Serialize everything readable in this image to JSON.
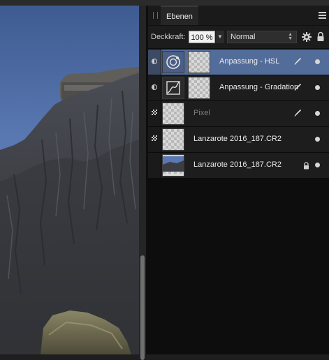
{
  "panel": {
    "tab_label": "Ebenen",
    "opacity_label": "Deckkraft:",
    "opacity_value": "100 %",
    "blend_mode": "Normal"
  },
  "layers": [
    {
      "name": "Anpassung - HSL",
      "type": "adjustment",
      "icon": "hsl-adjustment-icon",
      "selected": true,
      "has_brush": true,
      "locked": false
    },
    {
      "name": "Anpassung - Gradation",
      "type": "adjustment",
      "icon": "curves-adjustment-icon",
      "selected": false,
      "has_brush": true,
      "locked": false
    },
    {
      "name": "Pixel",
      "type": "pixel",
      "icon": "pixel-layer-icon",
      "selected": false,
      "has_brush": true,
      "locked": false,
      "muted": true
    },
    {
      "name": "Lanzarote 2016_187.CR2",
      "type": "image",
      "icon": "image-layer-icon",
      "selected": false,
      "has_brush": false,
      "locked": false
    },
    {
      "name": "Lanzarote 2016_187.CR2",
      "type": "image-background",
      "icon": "photo-thumbnail",
      "selected": false,
      "has_brush": false,
      "locked": true
    }
  ],
  "colors": {
    "selected_row": "#536d9a",
    "panel_bg": "#0d0d0d",
    "row_bg": "#1d1d1d"
  }
}
